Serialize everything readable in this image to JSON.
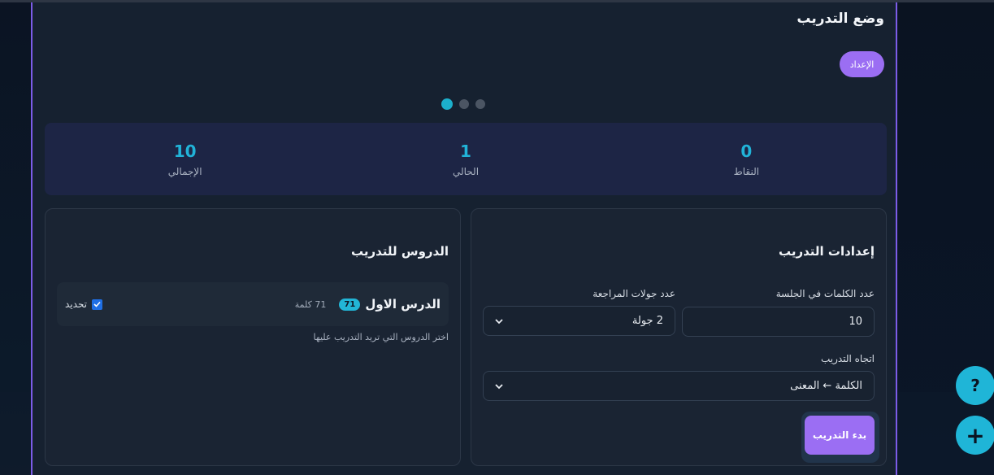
{
  "page": {
    "title": "وضع التدريب",
    "setup_badge": "الإعداد"
  },
  "carousel": {
    "dot_count": 3,
    "active_index": 0
  },
  "stats": [
    {
      "value": "0",
      "label": "النقاط"
    },
    {
      "value": "1",
      "label": "الحالي"
    },
    {
      "value": "10",
      "label": "الإجمالي"
    }
  ],
  "settings": {
    "title": "إعدادات التدريب",
    "words_label": "عدد الكلمات في الجلسة",
    "words_value": "10",
    "rounds_label": "عدد جولات المراجعة",
    "rounds_value": "2 جولة",
    "direction_label": "اتجاه التدريب",
    "direction_value": "الكلمة ← المعنى",
    "start_button": "بدء التدريب"
  },
  "lessons": {
    "title": "الدروس للتدريب",
    "items": [
      {
        "name": "الدرس الاول",
        "count_badge": "71",
        "words": "71 كلمة",
        "select_label": "تحديد",
        "checked": true
      }
    ],
    "hint": "اختر الدروس التي تريد التدريب عليها"
  },
  "fabs": {
    "help": "?",
    "add": "+"
  },
  "colors": {
    "accent_purple": "#9b6ef3",
    "accent_cyan": "#1fb5d7",
    "panel_border": "#7c5ce8"
  }
}
